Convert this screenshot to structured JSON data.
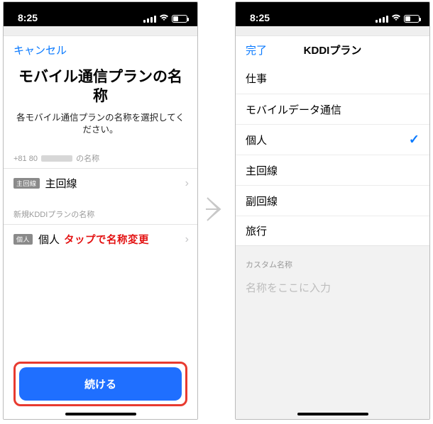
{
  "statusbar": {
    "time": "8:25"
  },
  "left": {
    "nav": {
      "cancel": "キャンセル"
    },
    "hero": {
      "title": "モバイル通信プランの名称",
      "subtitle": "各モバイル通信プランの名称を選択してください。"
    },
    "section1": {
      "caption_prefix": "+81 80",
      "caption_suffix": "の名称",
      "badge": "主回線",
      "label": "主回線"
    },
    "section2": {
      "caption": "新規KDDIプランの名称",
      "badge": "個人",
      "label": "個人",
      "annotation": "タップで名称変更"
    },
    "continue": "続ける"
  },
  "right": {
    "nav": {
      "done": "完了",
      "title": "KDDIプラン"
    },
    "options": [
      {
        "label": "仕事",
        "selected": false
      },
      {
        "label": "モバイルデータ通信",
        "selected": false
      },
      {
        "label": "個人",
        "selected": true
      },
      {
        "label": "主回線",
        "selected": false
      },
      {
        "label": "副回線",
        "selected": false
      },
      {
        "label": "旅行",
        "selected": false
      }
    ],
    "custom": {
      "header": "カスタム名称",
      "placeholder": "名称をここに入力"
    }
  }
}
